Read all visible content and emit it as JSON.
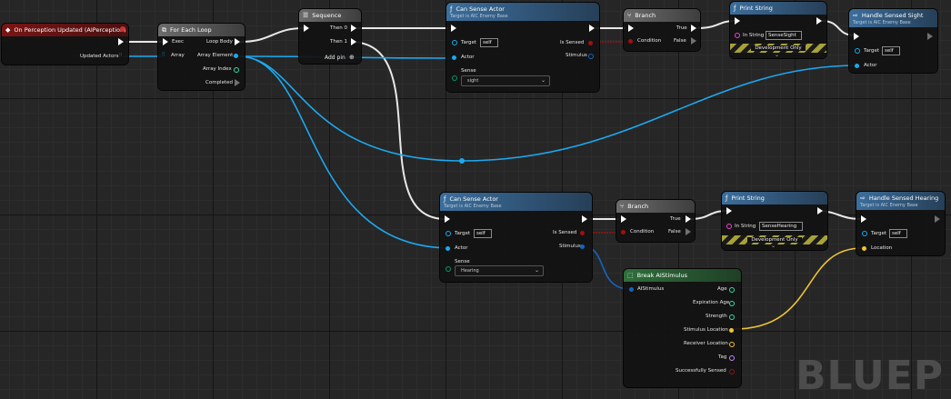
{
  "colors": {
    "exec": "#ffffff",
    "object": "#1ca9f0",
    "bool": "#a01010",
    "struct": "#1565c0",
    "vector": "#f1c530",
    "string": "#f542d4",
    "name": "#c68cff",
    "float": "#38e0a0"
  },
  "nodes": {
    "event": {
      "title": "On Perception Updated (AIPerception)",
      "updated_actors": "Updated Actors"
    },
    "foreach": {
      "title": "For Each Loop",
      "exec": "Exec",
      "array": "Array",
      "loop_body": "Loop Body",
      "array_element": "Array Element",
      "array_index": "Array Index",
      "completed": "Completed"
    },
    "sequence": {
      "title": "Sequence",
      "then0": "Then 0",
      "then1": "Then 1",
      "add_pin": "Add pin"
    },
    "can_sense_1": {
      "title": "Can Sense Actor",
      "subtitle": "Target is AIC Enemy Base",
      "target": "Target",
      "target_value": "self",
      "actor": "Actor",
      "sense": "Sense",
      "sense_value": "sight",
      "is_sensed": "Is Sensed",
      "stimulus": "Stimulus"
    },
    "branch_1": {
      "title": "Branch",
      "condition": "Condition",
      "true": "True",
      "false": "False"
    },
    "print_1": {
      "title": "Print String",
      "in_string": "In String",
      "in_string_value": "SenseSight",
      "dev_only": "Development Only"
    },
    "handle_sight": {
      "title": "Handle Sensed Sight",
      "subtitle": "Target is AIC Enemy Base",
      "target": "Target",
      "target_value": "self",
      "actor": "Actor"
    },
    "can_sense_2": {
      "title": "Can Sense Actor",
      "subtitle": "Target is AIC Enemy Base",
      "target": "Target",
      "target_value": "self",
      "actor": "Actor",
      "sense": "Sense",
      "sense_value": "Hearing",
      "is_sensed": "Is Sensed",
      "stimulus": "Stimulus"
    },
    "branch_2": {
      "title": "Branch",
      "condition": "Condition",
      "true": "True",
      "false": "False"
    },
    "print_2": {
      "title": "Print String",
      "in_string": "In String",
      "in_string_value": "SenseHearing",
      "dev_only": "Development Only"
    },
    "handle_hearing": {
      "title": "Handle Sensed Hearing",
      "subtitle": "Target is AIC Enemy Base",
      "target": "Target",
      "target_value": "self",
      "location": "Location"
    },
    "break_stimulus": {
      "title": "Break AIStimulus",
      "ai_stimulus": "AIStimulus",
      "age": "Age",
      "expiration_age": "Expiration Age",
      "strength": "Strength",
      "stimulus_location": "Stimulus Location",
      "receiver_location": "Receiver Location",
      "tag": "Tag",
      "successfully_sensed": "Successfully Sensed"
    }
  },
  "watermark": "BLUEP"
}
